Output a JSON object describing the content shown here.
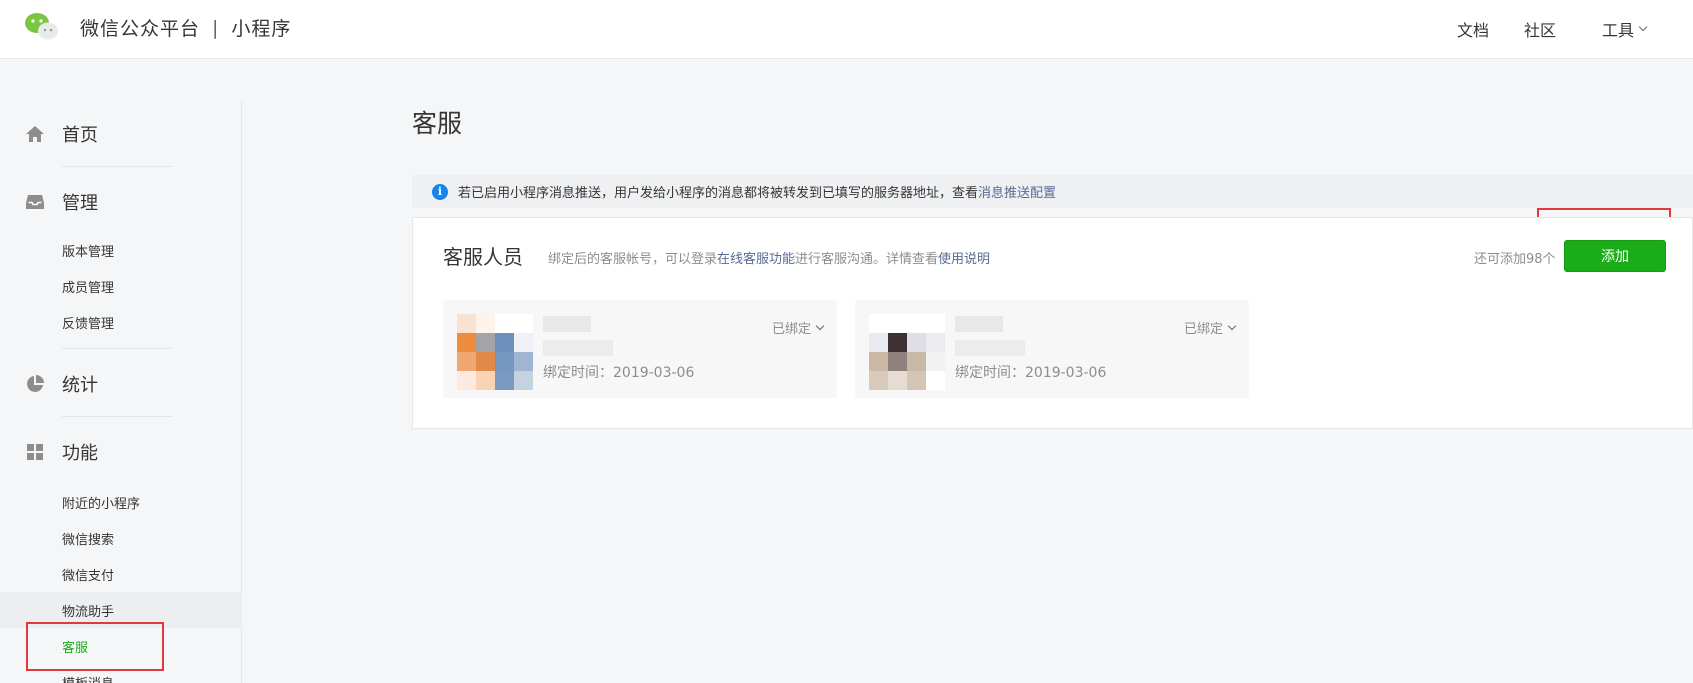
{
  "header": {
    "brand_name": "微信公众平台",
    "separator": "|",
    "product": "小程序",
    "nav": {
      "docs": "文档",
      "community": "社区",
      "tools": "工具"
    }
  },
  "sidebar": {
    "sections": [
      {
        "label": "首页",
        "icon": "home-icon"
      },
      {
        "label": "管理",
        "icon": "inbox-icon"
      },
      {
        "label": "统计",
        "icon": "pie-chart-icon"
      },
      {
        "label": "功能",
        "icon": "grid-icon"
      }
    ],
    "manage_items": [
      "版本管理",
      "成员管理",
      "反馈管理"
    ],
    "feature_items": [
      "附近的小程序",
      "微信搜索",
      "微信支付",
      "物流助手",
      "客服",
      "模板消息"
    ],
    "active_item": "客服"
  },
  "main": {
    "title": "客服",
    "notice": {
      "text": "若已启用小程序消息推送，用户发给小程序的消息都将被转发到已填写的服务器地址，查看",
      "link": "消息推送配置"
    },
    "panel": {
      "title": "客服人员",
      "desc_prefix": "绑定后的客服帐号，可以登录",
      "desc_link1": "在线客服功能",
      "desc_middle": "进行客服沟通。详情查看",
      "desc_link2": "使用说明",
      "remaining": "还可添加98个",
      "add_button": "添加"
    },
    "agents": [
      {
        "status": "已绑定",
        "bind_time": "绑定时间：2019-03-06"
      },
      {
        "status": "已绑定",
        "bind_time": "绑定时间：2019-03-06"
      }
    ]
  },
  "colors": {
    "accent": "#1aad19",
    "link": "#576b95",
    "highlight": "#e4393c",
    "info": "#1485ee"
  }
}
